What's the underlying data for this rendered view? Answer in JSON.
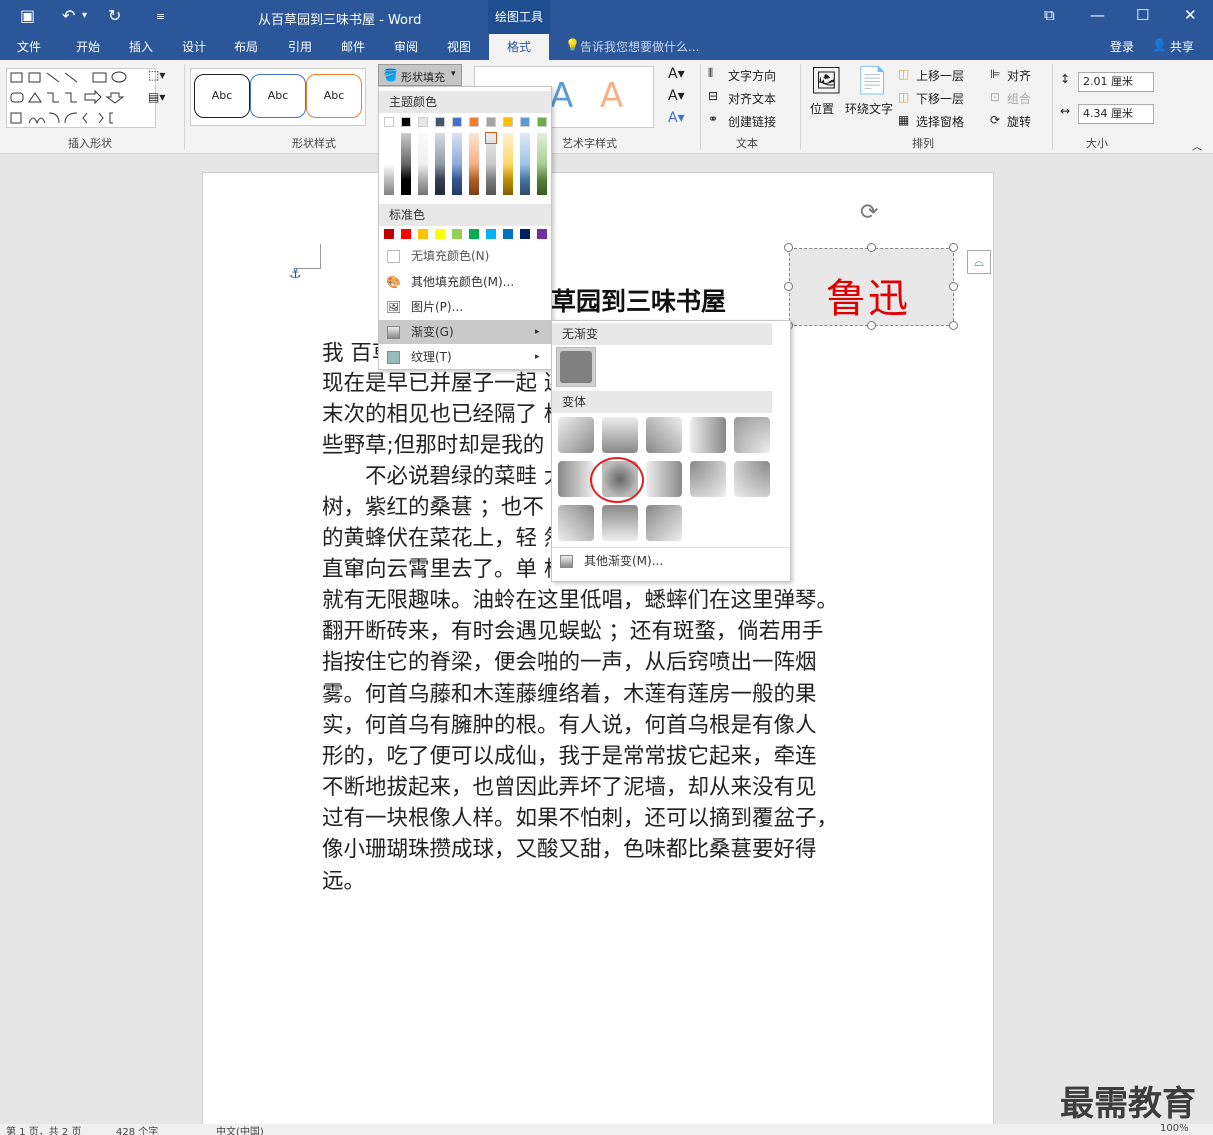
{
  "app": {
    "doc_title": "从百草园到三味书屋 - Word",
    "context_tool": "绘图工具"
  },
  "tabs": [
    "文件",
    "开始",
    "插入",
    "设计",
    "布局",
    "引用",
    "邮件",
    "审阅",
    "视图",
    "格式"
  ],
  "active_tab": "格式",
  "tell_me": "告诉我您想要做什么...",
  "login": "登录",
  "share": "共享",
  "ribbon": {
    "groups": {
      "insert_shapes": "插入形状",
      "shape_styles": "形状样式",
      "art_styles": "艺术字样式",
      "text": "文本",
      "arrange": "排列",
      "size": "大小"
    },
    "shape_fill": "形状填充",
    "style_preview": "Abc",
    "text_direction": "文字方向",
    "align_text": "对齐文本",
    "create_link": "创建链接",
    "position": "位置",
    "wrap_text": "环绕文字",
    "bring_forward": "上移一层",
    "send_backward": "下移一层",
    "selection_pane": "选择窗格",
    "align": "对齐",
    "group": "组合",
    "rotate": "旋转",
    "height": "2.01 厘米",
    "width": "4.34 厘米"
  },
  "fill_menu": {
    "theme_colors": "主题颜色",
    "standard_colors": "标准色",
    "no_fill": "无填充颜色(N)",
    "more_colors": "其他填充颜色(M)...",
    "picture": "图片(P)...",
    "gradient": "渐变(G)",
    "texture": "纹理(T)",
    "theme_top": [
      "#ffffff",
      "#000000",
      "#e7e6e6",
      "#44546a",
      "#4472c4",
      "#ed7d31",
      "#a5a5a5",
      "#ffc000",
      "#5b9bd5",
      "#70ad47"
    ],
    "standard": [
      "#c00000",
      "#ff0000",
      "#ffc000",
      "#ffff00",
      "#92d050",
      "#00b050",
      "#00b0f0",
      "#0070c0",
      "#002060",
      "#7030a0"
    ]
  },
  "gradient_menu": {
    "no_gradient": "无渐变",
    "variants": "变体",
    "more_gradients": "其他渐变(M)..."
  },
  "document": {
    "heading": "草园到三味书屋",
    "textbox": "鲁迅",
    "lines": [
      "我                                                   百草园。",
      "现在是早已并屋子一起                    连那最",
      "末次的相见也已经隔了                    档只有一",
      "些野草;但那时却是我的",
      "　　不必说碧绿的菜畦                     大的皂荚",
      "树，紫红的桑葚 ；也不                    吟，肥胖",
      "的黄蜂伏在菜花上，轻                     然从草间",
      "直窜向云霄里去了。单                    根一带，",
      "就有无限趣味。油蛉在这里低唱，蟋蟀们在这里弹琴。",
      "翻开断砖来，有时会遇见蜈蚣 ；还有斑蝥，倘若用手",
      "指按住它的脊梁，便会啪的一声，从后窍喷出一阵烟",
      "雾。何首乌藤和木莲藤缠络着，木莲有莲房一般的果",
      "实，何首乌有臃肿的根。有人说，何首乌根是有像人",
      "形的，吃了便可以成仙，我于是常常拔它起来，牵连",
      "不断地拔起来，也曾因此弄坏了泥墙，却从来没有见",
      "过有一块根像人样。如果不怕刺，还可以摘到覆盆子，",
      "像小珊瑚珠攒成球，又酸又甜，色味都比桑葚要好得",
      "远。"
    ]
  },
  "status": {
    "page": "第 1 页，共 2 页",
    "words": "428 个字",
    "lang": "中文(中国)",
    "zoom": "100%"
  },
  "watermark": "最需教育"
}
